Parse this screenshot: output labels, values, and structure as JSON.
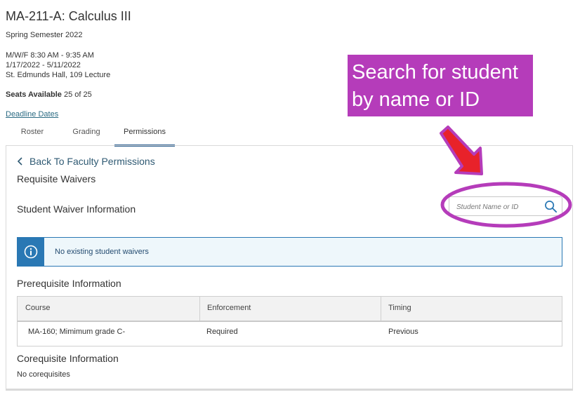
{
  "course": {
    "title": "MA-211-A: Calculus III",
    "term": "Spring Semester 2022",
    "schedule": "M/W/F 8:30 AM - 9:35 AM",
    "dates": "1/17/2022 - 5/11/2022",
    "location": "St. Edmunds Hall, 109 Lecture",
    "seats_label": "Seats Available",
    "seats_value": "25 of 25",
    "deadline_link": "Deadline Dates"
  },
  "tabs": [
    {
      "label": "Roster",
      "active": false
    },
    {
      "label": "Grading",
      "active": false
    },
    {
      "label": "Permissions",
      "active": true
    }
  ],
  "panel": {
    "back_link": "Back To Faculty Permissions",
    "section_title": "Requisite Waivers",
    "waiver_heading": "Student Waiver Information",
    "search_placeholder": "Student Name or ID",
    "info_message": "No existing student waivers",
    "prereq_heading": "Prerequisite Information",
    "prereq_table": {
      "headers": [
        "Course",
        "Enforcement",
        "Timing"
      ],
      "rows": [
        [
          "MA-160; Mimimum grade C-",
          "Required",
          "Previous"
        ]
      ]
    },
    "coreq_heading": "Corequisite Information",
    "coreq_none": "No corequisites"
  },
  "annotation": {
    "line1": "Search for student",
    "line2": "by name or ID",
    "callout_color": "#b53cba",
    "arrow_color": "#e8222a"
  },
  "colors": {
    "accent_blue": "#2a78b4",
    "tab_underline": "#2b5e8f",
    "link": "#2b6b83"
  },
  "icons": [
    "chevron-left-icon",
    "search-icon",
    "info-icon"
  ]
}
